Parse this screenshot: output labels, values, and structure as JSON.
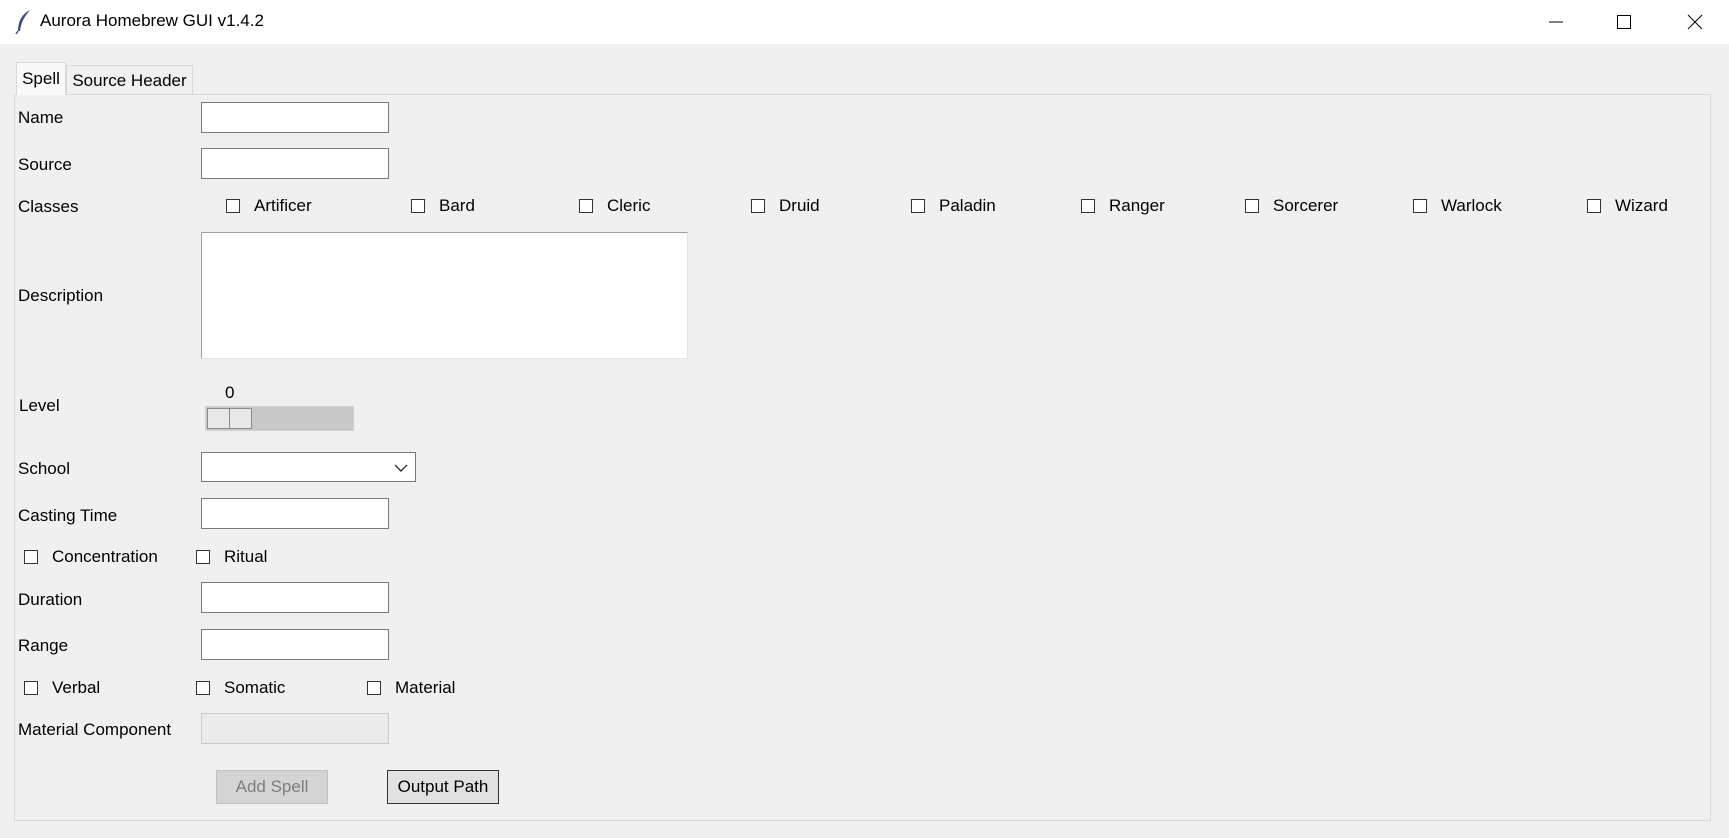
{
  "window": {
    "title": "Aurora Homebrew GUI v1.4.2",
    "icon": "feather-icon"
  },
  "tabs": [
    {
      "label": "Spell",
      "selected": true
    },
    {
      "label": "Source Header",
      "selected": false
    }
  ],
  "form": {
    "name_label": "Name",
    "name_value": "",
    "source_label": "Source",
    "source_value": "",
    "classes_label": "Classes",
    "classes": [
      "Artificer",
      "Bard",
      "Cleric",
      "Druid",
      "Paladin",
      "Ranger",
      "Sorcerer",
      "Warlock",
      "Wizard"
    ],
    "description_label": "Description",
    "description_value": "",
    "level_label": "Level",
    "level_value": "0",
    "school_label": "School",
    "school_value": "",
    "casting_time_label": "Casting Time",
    "casting_time_value": "",
    "concentration_label": "Concentration",
    "ritual_label": "Ritual",
    "duration_label": "Duration",
    "duration_value": "",
    "range_label": "Range",
    "range_value": "",
    "verbal_label": "Verbal",
    "somatic_label": "Somatic",
    "material_label": "Material",
    "material_component_label": "Material Component",
    "material_component_value": ""
  },
  "buttons": {
    "add_spell": "Add Spell",
    "output_path": "Output Path"
  }
}
